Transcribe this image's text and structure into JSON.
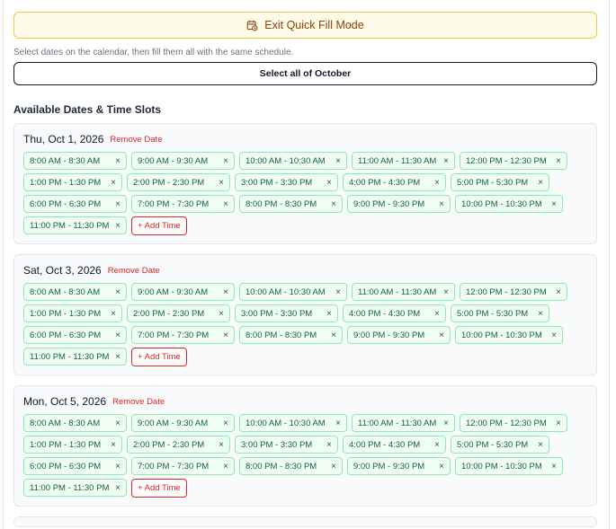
{
  "quick_fill": {
    "exit_label": "Exit Quick Fill Mode",
    "hint": "Select dates on the calendar, then fill them all with the same schedule.",
    "select_all_label": "Select all of October"
  },
  "section_title": "Available Dates & Time Slots",
  "remove_label": "Remove Date",
  "add_time_label": "+ Add Time",
  "remove_slot_glyph": "×",
  "colors": {
    "exit_bg": "#fefbe8",
    "exit_border": "#f1c84b",
    "chip_bg": "#f0fdf4",
    "chip_border": "#86efac",
    "chip_text": "#166534",
    "danger": "#dc2626"
  },
  "dates": [
    {
      "label": "Thu, Oct 1, 2026",
      "slots": [
        "8:00 AM - 8:30 AM",
        "9:00 AM - 9:30 AM",
        "10:00 AM - 10:30 AM",
        "11:00 AM - 11:30 AM",
        "12:00 PM - 12:30 PM",
        "1:00 PM - 1:30 PM",
        "2:00 PM - 2:30 PM",
        "3:00 PM - 3:30 PM",
        "4:00 PM - 4:30 PM",
        "5:00 PM - 5:30 PM",
        "6:00 PM - 6:30 PM",
        "7:00 PM - 7:30 PM",
        "8:00 PM - 8:30 PM",
        "9:00 PM - 9:30 PM",
        "10:00 PM - 10:30 PM",
        "11:00 PM - 11:30 PM"
      ]
    },
    {
      "label": "Sat, Oct 3, 2026",
      "slots": [
        "8:00 AM - 8:30 AM",
        "9:00 AM - 9:30 AM",
        "10:00 AM - 10:30 AM",
        "11:00 AM - 11:30 AM",
        "12:00 PM - 12:30 PM",
        "1:00 PM - 1:30 PM",
        "2:00 PM - 2:30 PM",
        "3:00 PM - 3:30 PM",
        "4:00 PM - 4:30 PM",
        "5:00 PM - 5:30 PM",
        "6:00 PM - 6:30 PM",
        "7:00 PM - 7:30 PM",
        "8:00 PM - 8:30 PM",
        "9:00 PM - 9:30 PM",
        "10:00 PM - 10:30 PM",
        "11:00 PM - 11:30 PM"
      ]
    },
    {
      "label": "Mon, Oct 5, 2026",
      "slots": [
        "8:00 AM - 8:30 AM",
        "9:00 AM - 9:30 AM",
        "10:00 AM - 10:30 AM",
        "11:00 AM - 11:30 AM",
        "12:00 PM - 12:30 PM",
        "1:00 PM - 1:30 PM",
        "2:00 PM - 2:30 PM",
        "3:00 PM - 3:30 PM",
        "4:00 PM - 4:30 PM",
        "5:00 PM - 5:30 PM",
        "6:00 PM - 6:30 PM",
        "7:00 PM - 7:30 PM",
        "8:00 PM - 8:30 PM",
        "9:00 PM - 9:30 PM",
        "10:00 PM - 10:30 PM",
        "11:00 PM - 11:30 PM"
      ]
    }
  ]
}
